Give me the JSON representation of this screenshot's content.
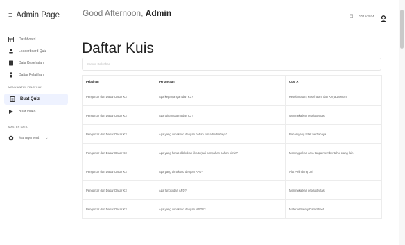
{
  "app": {
    "title": "Admin Page"
  },
  "header": {
    "greeting": "Good Afternoon,",
    "user": "Admin",
    "date": "07/15/2024"
  },
  "sidebar": {
    "items": [
      {
        "label": "Dashboard",
        "icon": "dashboard-icon"
      },
      {
        "label": "Leaderboard Quiz",
        "icon": "leaderboard-icon"
      },
      {
        "label": "Data Kesehatan",
        "icon": "book-icon"
      },
      {
        "label": "Daftar Pelatihan",
        "icon": "person-icon"
      }
    ],
    "section_menu": "MENU UNTUK PELATIHAN",
    "menu_items": [
      {
        "label": "Buat Quiz",
        "icon": "quiz-icon",
        "active": true
      },
      {
        "label": "Buat Video",
        "icon": "video-icon",
        "active": false
      }
    ],
    "section_master": "MASTER DATA",
    "master_items": [
      {
        "label": "Management",
        "icon": "settings-icon"
      }
    ]
  },
  "main": {
    "title": "Daftar Kuis",
    "filter_placeholder": "Semua Pelatihan",
    "table": {
      "headers": [
        "Pelatihan",
        "Pertanyaan",
        "Opsi A"
      ],
      "rows": [
        [
          "Pengantar dan Dasar-Dasar K3",
          "Apa kepanjangan dari K3?",
          "Keselamatan, Kesehatan, dan Kerja Jasmani"
        ],
        [
          "Pengantar dan Dasar-Dasar K3",
          "Apa tujuan utama dari K3?",
          "Meningkatkan produktivitas"
        ],
        [
          "Pengantar dan Dasar-Dasar K3",
          "Apa yang dimaksud dengan bahan kimia berbahaya?",
          "Bahan yang tidak berbahaya"
        ],
        [
          "Pengantar dan Dasar-Dasar K3",
          "Apa yang harus dilakukan jika terjadi tumpahan bahan kimia?",
          "Meninggalkan area tanpa memberitahu orang lain"
        ],
        [
          "Pengantar dan Dasar-Dasar K3",
          "Apa yang dimaksud dengan APD?",
          "Alat Pelindung Diri"
        ],
        [
          "Pengantar dan Dasar-Dasar K3",
          "Apa fungsi dari APD?",
          "Meningkatkan produktivitas"
        ],
        [
          "Pengantar dan Dasar-Dasar K3",
          "Apa yang dimaksud dengan MSDS?",
          "Material Safety Data Sheet"
        ]
      ]
    }
  },
  "colors": {
    "active_bg": "#eef2ff",
    "text_dark": "#222222",
    "text_muted": "#666666",
    "border": "#ececec"
  }
}
